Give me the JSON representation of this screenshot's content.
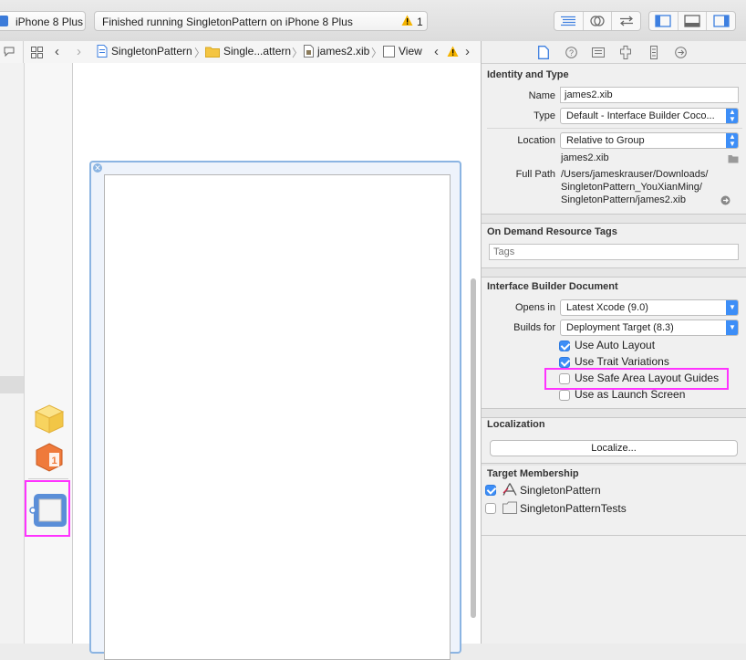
{
  "toolbar": {
    "scheme_device": "iPhone 8 Plus",
    "activity_status": "Finished running SingletonPattern on iPhone 8 Plus",
    "warning_count": "1"
  },
  "jumpbar": {
    "crumbs": [
      "SingletonPattern",
      "Single...attern",
      "james2.xib",
      "View"
    ]
  },
  "inspector": {
    "identity": {
      "title": "Identity and Type",
      "name_label": "Name",
      "name_value": "james2.xib",
      "type_label": "Type",
      "type_value": "Default - Interface Builder Coco...",
      "location_label": "Location",
      "location_value": "Relative to Group",
      "location_file": "james2.xib",
      "full_path_label": "Full Path",
      "full_path_lines": [
        "/Users/jameskrauser/Downloads/",
        "SingletonPattern_YouXianMing/",
        "SingletonPattern/james2.xib"
      ]
    },
    "odr": {
      "title": "On Demand Resource Tags",
      "tags_placeholder": "Tags"
    },
    "ib_document": {
      "title": "Interface Builder Document",
      "opens_in_label": "Opens in",
      "opens_in_value": "Latest Xcode (9.0)",
      "builds_for_label": "Builds for",
      "builds_for_value": "Deployment Target (8.3)",
      "options": [
        {
          "label": "Use Auto Layout",
          "checked": true
        },
        {
          "label": "Use Trait Variations",
          "checked": true
        },
        {
          "label": "Use Safe Area Layout Guides",
          "checked": false
        },
        {
          "label": "Use as Launch Screen",
          "checked": false
        }
      ]
    },
    "localization": {
      "title": "Localization",
      "button": "Localize..."
    },
    "target_membership": {
      "title": "Target Membership",
      "targets": [
        {
          "label": "SingletonPattern",
          "checked": true
        },
        {
          "label": "SingletonPatternTests",
          "checked": false
        }
      ]
    }
  },
  "colors": {
    "accent": "#3d8ef7",
    "highlight": "#ff33ff",
    "warning": "#f5b400"
  }
}
